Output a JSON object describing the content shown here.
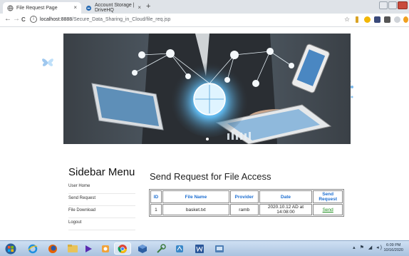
{
  "browser": {
    "tabs": [
      {
        "title": "File Request Page",
        "close": "×"
      },
      {
        "title": "Account Storage | DriveHQ",
        "close": "×"
      }
    ],
    "new_tab": "+",
    "url_host": "localhost:8888",
    "url_path": "/Secure_Data_Sharing_in_Cloud/file_req.jsp",
    "back": "←",
    "forward": "→",
    "reload": "C",
    "bookmark_star": "☆"
  },
  "sidebar": {
    "title": "Sidebar Menu",
    "items": [
      {
        "label": "User Home"
      },
      {
        "label": "Send Request"
      },
      {
        "label": "File Download"
      },
      {
        "label": "Logout"
      }
    ]
  },
  "main": {
    "title": "Send Request for File Access",
    "table": {
      "headers": [
        "ID",
        "File Name",
        "Provider",
        "Date",
        "Send Request"
      ],
      "rows": [
        {
          "id": "1",
          "file_name": "basket.txt",
          "provider": "ramb",
          "date": "2020.10.12 AD at 14:08:00",
          "action": "Send"
        }
      ]
    }
  },
  "taskbar": {
    "time": "6:09 PM",
    "date": "10/16/2020"
  },
  "colors": {
    "header_text": "#1e6fd1",
    "link": "#1a8c1a",
    "taskbar": "#b9cfe9"
  }
}
